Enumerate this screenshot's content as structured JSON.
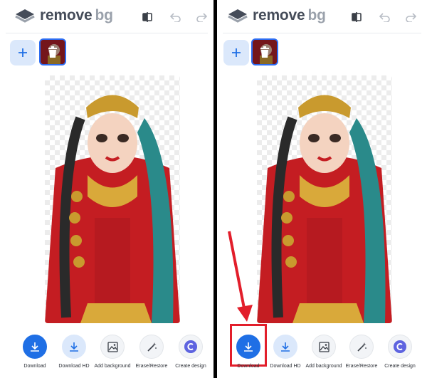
{
  "logo": {
    "word1": "remove",
    "word2": "bg"
  },
  "toolbar": {
    "download": "Download",
    "download_hd": "Download HD",
    "add_background": "Add background",
    "erase_restore": "Erase/Restore",
    "create_design": "Create design"
  },
  "colors": {
    "accent": "#1f6fe5",
    "accent_light": "#dbe8fb",
    "highlight": "#e21e2b",
    "logo_dark": "#454c59",
    "logo_light": "#9aa1ab"
  },
  "icons": [
    "logo-layers-icon",
    "compare-icon",
    "undo-icon",
    "redo-icon",
    "plus-icon",
    "trash-icon",
    "download-icon",
    "image-icon",
    "magic-wand-icon",
    "canva-icon",
    "arrow-pointer"
  ]
}
